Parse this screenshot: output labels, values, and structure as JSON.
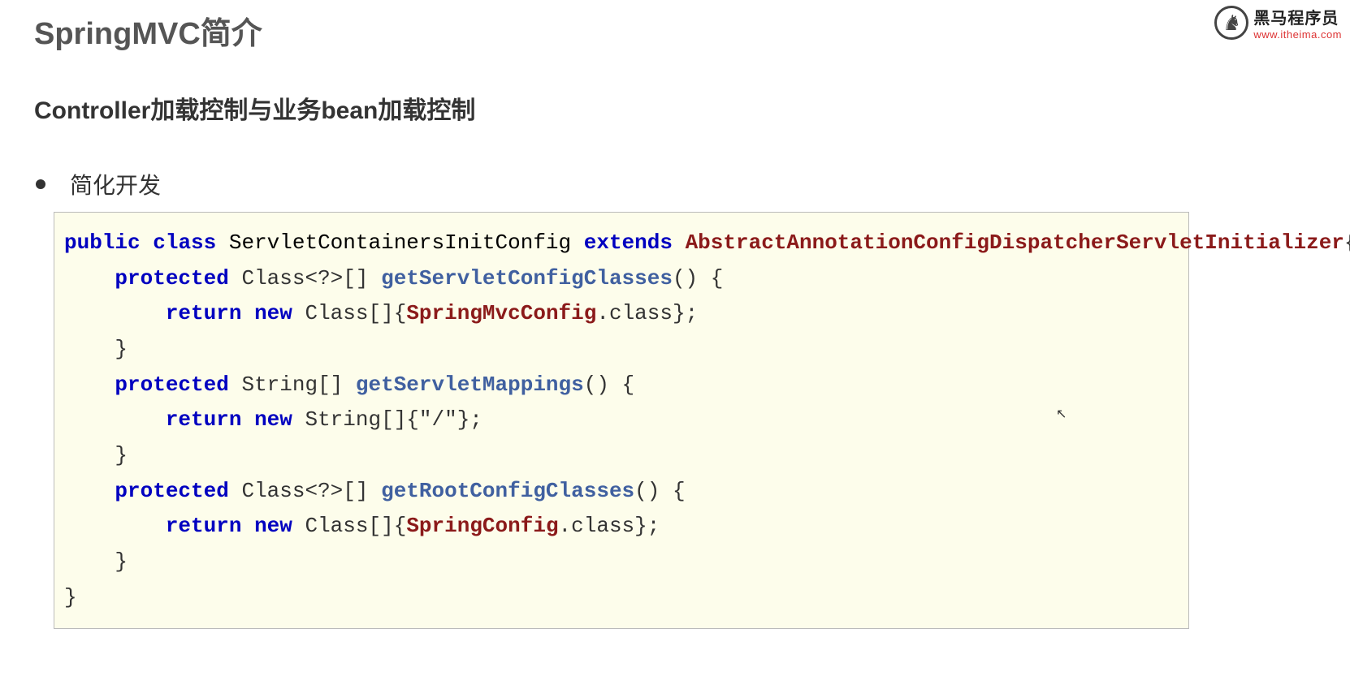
{
  "header": {
    "title": "SpringMVC简介",
    "subtitle": "Controller加载控制与业务bean加载控制",
    "bullet": "简化开发"
  },
  "logo": {
    "cn": "黑马程序员",
    "url": "www.itheima.com"
  },
  "code": {
    "tokens": [
      {
        "cls": "kw",
        "t": "public"
      },
      {
        "cls": "",
        "t": " "
      },
      {
        "cls": "kw",
        "t": "class"
      },
      {
        "cls": "",
        "t": " "
      },
      {
        "cls": "cname",
        "t": "ServletContainersInitConfig"
      },
      {
        "cls": "",
        "t": " "
      },
      {
        "cls": "kw",
        "t": "extends"
      },
      {
        "cls": "",
        "t": " "
      },
      {
        "cls": "redtype",
        "t": "AbstractAnnotationConfigDispatcherServletInitializer"
      },
      {
        "cls": "",
        "t": "{"
      },
      {
        "cls": "",
        "t": "\n    "
      },
      {
        "cls": "kw",
        "t": "protected"
      },
      {
        "cls": "",
        "t": " Class<?>[] "
      },
      {
        "cls": "method",
        "t": "getServletConfigClasses"
      },
      {
        "cls": "",
        "t": "() {"
      },
      {
        "cls": "",
        "t": "\n        "
      },
      {
        "cls": "kw",
        "t": "return"
      },
      {
        "cls": "",
        "t": " "
      },
      {
        "cls": "kw",
        "t": "new"
      },
      {
        "cls": "",
        "t": " Class[]{"
      },
      {
        "cls": "redtype",
        "t": "SpringMvcConfig"
      },
      {
        "cls": "",
        "t": ".class};"
      },
      {
        "cls": "",
        "t": "\n    }"
      },
      {
        "cls": "",
        "t": "\n    "
      },
      {
        "cls": "kw",
        "t": "protected"
      },
      {
        "cls": "",
        "t": " String[] "
      },
      {
        "cls": "method",
        "t": "getServletMappings"
      },
      {
        "cls": "",
        "t": "() {"
      },
      {
        "cls": "",
        "t": "\n        "
      },
      {
        "cls": "kw",
        "t": "return"
      },
      {
        "cls": "",
        "t": " "
      },
      {
        "cls": "kw",
        "t": "new"
      },
      {
        "cls": "",
        "t": " String[]{\"/\"};"
      },
      {
        "cls": "",
        "t": "\n    }"
      },
      {
        "cls": "",
        "t": "\n    "
      },
      {
        "cls": "kw",
        "t": "protected"
      },
      {
        "cls": "",
        "t": " Class<?>[] "
      },
      {
        "cls": "method",
        "t": "getRootConfigClasses"
      },
      {
        "cls": "",
        "t": "() {"
      },
      {
        "cls": "",
        "t": "\n        "
      },
      {
        "cls": "kw",
        "t": "return"
      },
      {
        "cls": "",
        "t": " "
      },
      {
        "cls": "kw",
        "t": "new"
      },
      {
        "cls": "",
        "t": " Class[]{"
      },
      {
        "cls": "redtype",
        "t": "SpringConfig"
      },
      {
        "cls": "",
        "t": ".class};"
      },
      {
        "cls": "",
        "t": "\n    }"
      },
      {
        "cls": "",
        "t": "\n}"
      }
    ]
  }
}
